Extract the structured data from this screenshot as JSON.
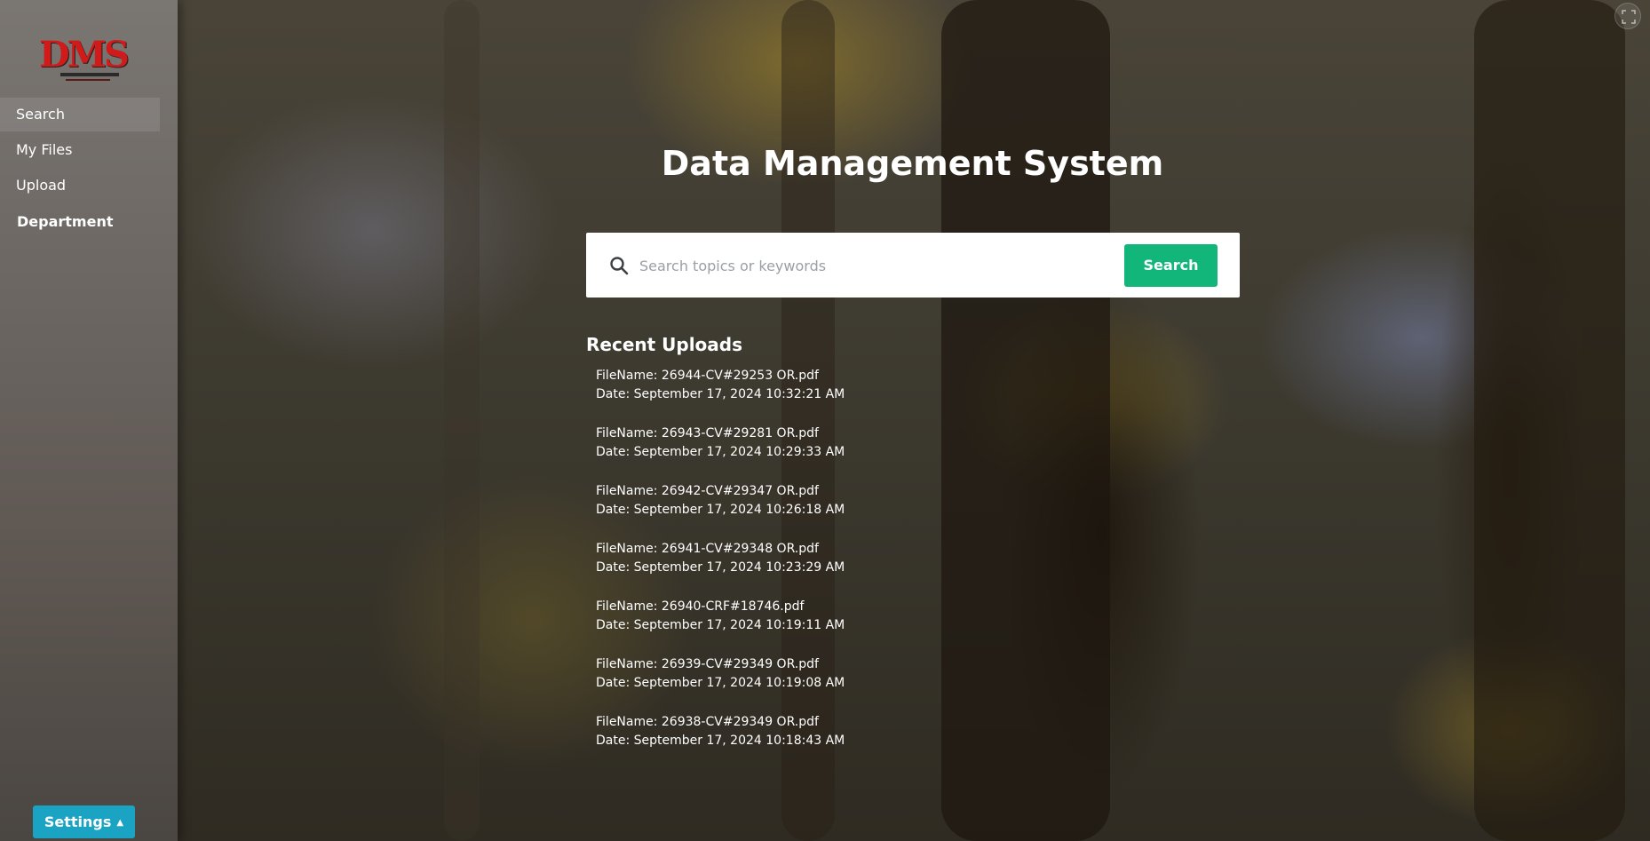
{
  "sidebar": {
    "logo_text": "DMS",
    "items": [
      {
        "label": "Search"
      },
      {
        "label": "My Files"
      },
      {
        "label": "Upload"
      },
      {
        "label": "Department"
      }
    ],
    "settings_label": "Settings"
  },
  "main": {
    "title": "Data Management System",
    "search": {
      "placeholder": "Search topics or keywords",
      "button_label": "Search"
    },
    "recent_uploads": {
      "title": "Recent Uploads",
      "items": [
        {
          "file": "FileName: 26944-CV#29253 OR.pdf",
          "date": "Date: September 17, 2024 10:32:21 AM"
        },
        {
          "file": "FileName: 26943-CV#29281 OR.pdf",
          "date": "Date: September 17, 2024 10:29:33 AM"
        },
        {
          "file": "FileName: 26942-CV#29347 OR.pdf",
          "date": "Date: September 17, 2024 10:26:18 AM"
        },
        {
          "file": "FileName: 26941-CV#29348 OR.pdf",
          "date": "Date: September 17, 2024 10:23:29 AM"
        },
        {
          "file": "FileName: 26940-CRF#18746.pdf",
          "date": "Date: September 17, 2024 10:19:11 AM"
        },
        {
          "file": "FileName: 26939-CV#29349 OR.pdf",
          "date": "Date: September 17, 2024 10:19:08 AM"
        },
        {
          "file": "FileName: 26938-CV#29349 OR.pdf",
          "date": "Date: September 17, 2024 10:18:43 AM"
        }
      ]
    }
  },
  "colors": {
    "search_button": "#13b67a",
    "settings_button": "#1aa3c2",
    "logo": "#d11a1a"
  },
  "icons": {
    "search": "search-icon",
    "fullscreen": "expand-icon",
    "settings_caret": "caret-up-icon"
  }
}
